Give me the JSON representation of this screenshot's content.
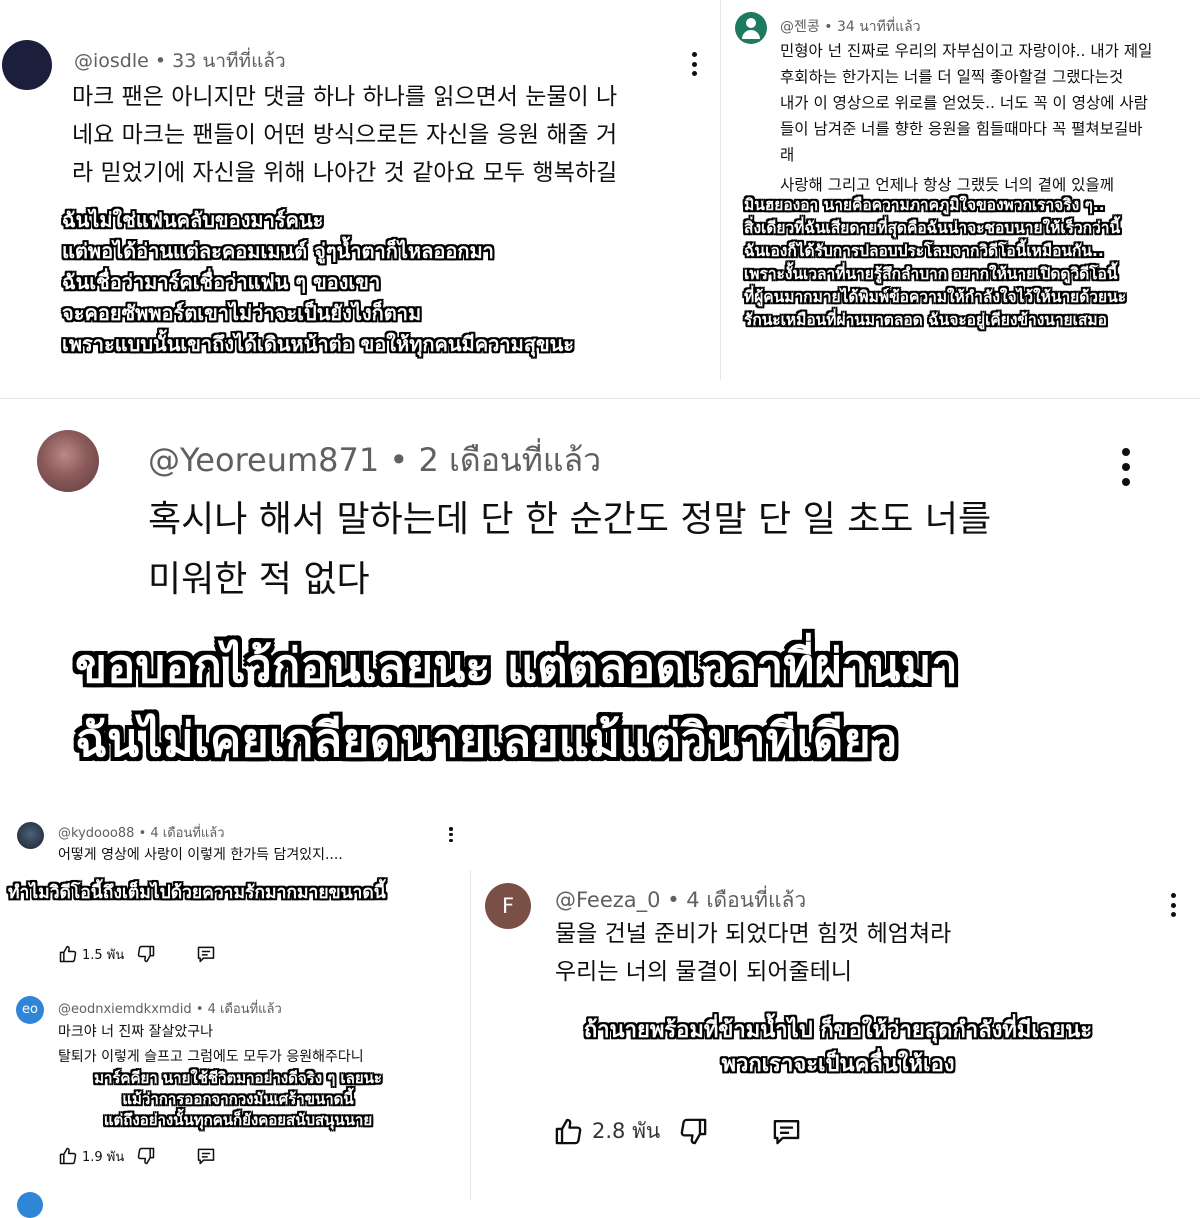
{
  "panel_top_left": {
    "handle": "@iosdle",
    "time": "33 นาทีที่แล้ว",
    "body_lines": [
      "마크 팬은 아니지만 댓글 하나 하나를 읽으면서 눈물이 나",
      "네요 마크는 팬들이 어떤 방식으로든 자신을 응원 해줄 거",
      "라 믿었기에 자신을 위해 나아간 것 같아요 모두 행복하길"
    ],
    "translation_lines": [
      "ฉันไม่ใช่แฟนคลับของมาร์คนะ",
      "แต่พอได้อ่านแต่ละคอมเมนต์ จู่ๆน้ำตาก็ไหลออกมา",
      "ฉันเชื่อว่ามาร์คเชื่อว่าแฟน ๆ ของเขา",
      "จะคอยซัพพอร์ตเขาไม่ว่าจะเป็นยังไงก็ตาม",
      "เพราะแบบนั้นเขาถึงได้เดินหน้าต่อ ขอให้ทุกคนมีความสุขนะ"
    ]
  },
  "panel_top_right": {
    "handle": "@젠콩",
    "time": "34 นาทีที่แล้ว",
    "body_lines": [
      "민형아 넌 진짜로 우리의 자부심이고 자랑이야.. 내가 제일",
      "후회하는 한가지는 너를 더 일찍 좋아할걸 그랬다는것",
      "내가 이 영상으로 위로를 얻었듯.. 너도 꼭 이 영상에 사람",
      "들이 남겨준 너를 향한 응원을 힘들때마다 꼭 펼쳐보길바",
      "래",
      "사랑해 그리고 언제나 항상 그랬듯 너의 곁에 있을께"
    ],
    "translation_lines": [
      "มินฮยองอา นายคือความภาคภูมิใจของพวกเราจริง ๆ..",
      "สิ่งเดียวที่ฉันเสียดายที่สุดคือฉันน่าจะชอบนายให้เร็วกว่านี้",
      "ฉันเองก็ได้รับการปลอบประโลมจากวิดีโอนี้เหมือนกัน..",
      "เพราะงั้นเวลาที่นายรู้สึกลำบาก อยากให้นายเปิดดูวิดีโอนี้",
      "ที่ผู้คนมากมายได้พิมพ์ข้อความให้กำลังใจไว้ให้นายด้วยนะ",
      "รักนะเหมือนที่ผ่านมาตลอด ฉันจะอยู่เคียงข้างนายเสมอ"
    ]
  },
  "panel_center": {
    "handle": "@Yeoreum871",
    "time": "2 เดือนที่แล้ว",
    "body_lines": [
      "혹시나 해서 말하는데 단 한 순간도 정말 단 일 초도 너를",
      "미워한 적 없다"
    ],
    "translation_lines": [
      "ขอบอกไว้ก่อนเลยนะ  แต่ตลอดเวลาที่ผ่านมา",
      "ฉันไม่เคยเกลียดนายเลยแม้แต่วินาทีเดียว"
    ]
  },
  "panel_bottom_left_1": {
    "handle": "@kydooo88",
    "time": "4 เดือนที่แล้ว",
    "body_lines": [
      "어떻게 영상에 사랑이 이렇게 한가득 담겨있지...."
    ],
    "translation_lines": [
      "ทำไมวิดีโอนี้ถึงเต็มไปด้วยความรักมากมายขนาดนี้"
    ],
    "like_count": "1.5 พัน"
  },
  "panel_bottom_left_2": {
    "avatar_initials": "eo",
    "handle": "@eodnxiemdkxmdid",
    "time": "4 เดือนที่แล้ว",
    "body_lines": [
      "마크야 너 진짜 잘살았구나",
      "탈퇴가 이렇게 슬프고 그럼에도 모두가 응원해주다니"
    ],
    "translation_lines": [
      "มาร์คคียา นายใช้ชีวิตมาอย่างดีจริง ๆ เลยนะ",
      "แม้ว่าการออกจากวงมันเศร้าขนาดนี้",
      "แต่ถึงอย่างนั้นทุกคนก็ยังคอยสนับสนุนนาย"
    ],
    "like_count": "1.9 พัน"
  },
  "panel_bottom_right": {
    "avatar_initials": "F",
    "handle": "@Feeza_0",
    "time": "4 เดือนที่แล้ว",
    "body_lines": [
      "물을 건널 준비가 되었다면 힘껏 헤엄쳐라",
      "우리는 너의 물결이 되어줄테니"
    ],
    "translation_lines": [
      "ถ้านายพร้อมที่ข้ามน้ำไป ก็ขอให้ว่ายสุดกำลังที่มีเลยนะ",
      "พวกเราจะเป็นคลื่นให้เอง"
    ],
    "like_count": "2.8 พัน"
  },
  "colors": {
    "avatar_iosdle": "#1b1f3b",
    "avatar_jenkong": "#1e7a5e",
    "avatar_kydooo": "#2d3b4c",
    "avatar_eo": "#2f86d6",
    "avatar_feeza": "#7a4f46",
    "avatar_yeoreum": "#8a5a5a"
  },
  "icons": [
    "kebab-menu-icon",
    "thumbs-up-icon",
    "thumbs-down-icon",
    "reply-comment-icon",
    "profile-avatar"
  ]
}
